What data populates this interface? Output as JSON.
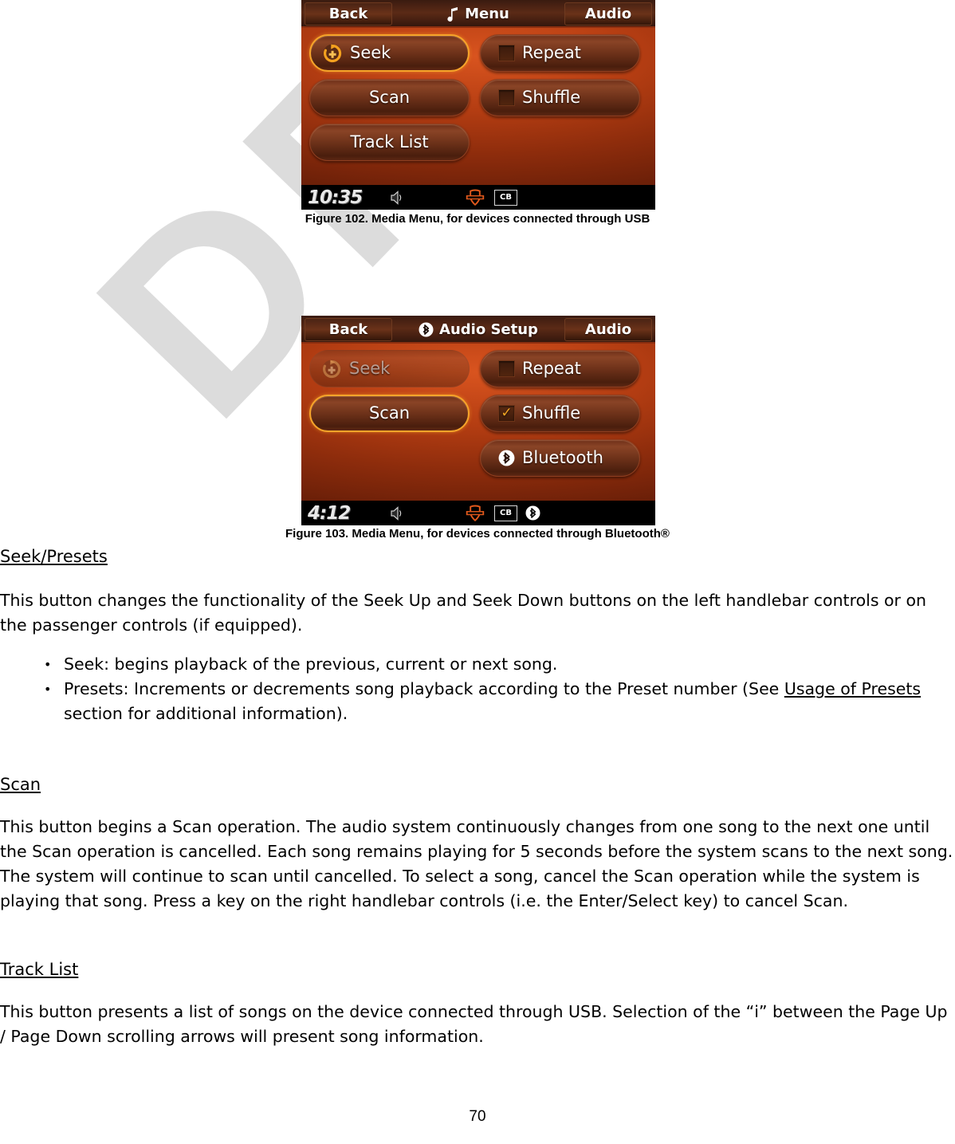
{
  "watermark": {
    "text": "DRAFT",
    "color": "#dcdcdc"
  },
  "page": {
    "number": "70"
  },
  "figures": [
    {
      "id": "figure-102",
      "caption": "Figure 102. Media Menu, for devices connected through USB",
      "header": {
        "back_label": "Back",
        "title": "Menu",
        "title_icon": "music-note-icon",
        "audio_label": "Audio"
      },
      "left_buttons": [
        {
          "label": "Seek",
          "icon": "seek-circular-arrow-plus-icon",
          "state": "selected"
        },
        {
          "label": "Scan",
          "icon": "none",
          "state": "normal"
        },
        {
          "label": "Track List",
          "icon": "none",
          "state": "normal"
        }
      ],
      "right_buttons": [
        {
          "label": "Repeat",
          "icon": "checkbox-unchecked-icon",
          "state": "normal"
        },
        {
          "label": "Shuffle",
          "icon": "checkbox-unchecked-icon",
          "state": "normal"
        }
      ],
      "status": {
        "clock": "10:35",
        "icons": [
          "speaker-icon",
          "harley-davidson-bar-and-shield-icon",
          "cb-radio-icon"
        ],
        "cb_label": "CB",
        "bluetooth_visible": false
      }
    },
    {
      "id": "figure-103",
      "caption": "Figure 103. Media Menu, for devices connected through Bluetooth®",
      "header": {
        "back_label": "Back",
        "title": "Audio Setup",
        "title_icon": "bluetooth-icon",
        "audio_label": "Audio"
      },
      "left_buttons": [
        {
          "label": "Seek",
          "icon": "seek-circular-arrow-plus-icon",
          "state": "disabled"
        },
        {
          "label": "Scan",
          "icon": "none",
          "state": "selected"
        }
      ],
      "right_buttons": [
        {
          "label": "Repeat",
          "icon": "checkbox-unchecked-icon",
          "state": "normal"
        },
        {
          "label": "Shuffle",
          "icon": "checkbox-checked-icon",
          "state": "normal"
        },
        {
          "label": "Bluetooth",
          "icon": "bluetooth-icon",
          "state": "normal"
        }
      ],
      "status": {
        "clock": "4:12",
        "icons": [
          "speaker-icon",
          "harley-davidson-bar-and-shield-icon",
          "cb-radio-icon",
          "bluetooth-icon"
        ],
        "cb_label": "CB",
        "bluetooth_visible": true
      }
    }
  ],
  "sections": {
    "seek_presets": {
      "heading": "Seek/Presets",
      "paragraph": "This button changes the functionality of the Seek Up and Seek Down buttons on the left handlebar controls or on the passenger controls (if equipped).",
      "bullets": [
        {
          "prefix": "Seek: begins playback of the previous, current or next song.",
          "link": "",
          "suffix": ""
        },
        {
          "prefix": "Presets: Increments or decrements song playback according to the Preset number (See ",
          "link": "Usage of Presets ",
          "suffix": "section for additional information)."
        }
      ]
    },
    "scan": {
      "heading": "Scan",
      "paragraph": "This button begins a Scan operation. The audio system continuously changes from one song to the next one until the Scan operation is cancelled. Each song remains playing for 5 seconds before the system scans to the next song. The system will continue to scan until cancelled. To select a song, cancel the Scan operation while the system is playing that song. Press a key on the right handlebar controls (i.e. the Enter/Select key) to cancel Scan."
    },
    "track_list": {
      "heading": "Track List",
      "paragraph": "This button presents a list of songs on the device connected through USB. Selection of the “i” between the Page Up / Page Down scrolling arrows will present song information."
    }
  }
}
